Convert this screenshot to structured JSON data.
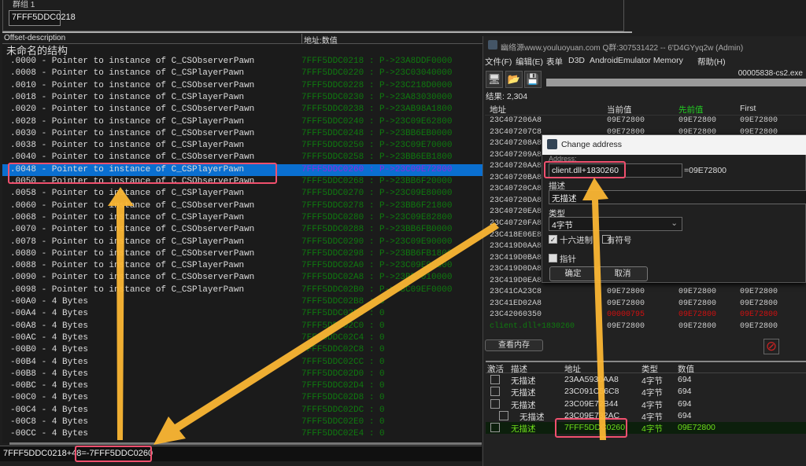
{
  "group": {
    "title": "群组 1",
    "address": "7FFF5DDC0218"
  },
  "struct": {
    "col_offset": "Offset-description",
    "col_value": "地址:数值",
    "title": "未命名的结构",
    "rows": [
      {
        "d": ".0000 - Pointer to instance of C_CSObserverPawn",
        "v": "7FFF5DDC0218 : P->23A8DDF0000"
      },
      {
        "d": ".0008 - Pointer to instance of C_CSPlayerPawn",
        "v": "7FFF5DDC0220 : P->23C03040000"
      },
      {
        "d": ".0010 - Pointer to instance of C_CSObserverPawn",
        "v": "7FFF5DDC0228 : P->23C218D0000"
      },
      {
        "d": ".0018 - Pointer to instance of C_CSPlayerPawn",
        "v": "7FFF5DDC0230 : P->23A83030000"
      },
      {
        "d": ".0020 - Pointer to instance of C_CSObserverPawn",
        "v": "7FFF5DDC0238 : P->23AB98A1800"
      },
      {
        "d": ".0028 - Pointer to instance of C_CSPlayerPawn",
        "v": "7FFF5DDC0240 : P->23C09E62800"
      },
      {
        "d": ".0030 - Pointer to instance of C_CSObserverPawn",
        "v": "7FFF5DDC0248 : P->23BB6EB0000"
      },
      {
        "d": ".0038 - Pointer to instance of C_CSPlayerPawn",
        "v": "7FFF5DDC0250 : P->23C09E70000"
      },
      {
        "d": ".0040 - Pointer to instance of C_CSObserverPawn",
        "v": "7FFF5DDC0258 : P->23BB6EB1800"
      },
      {
        "d": ".0048 - Pointer to instance of C_CSPlayerPawn",
        "v": "7FFF5DDC0260 : P->23C09E72800",
        "selected": true
      },
      {
        "d": ".0050 - Pointer to instance of C_CSObserverPawn",
        "v": "7FFF5DDC0268 : P->23BB6F20000"
      },
      {
        "d": ".0058 - Pointer to instance of C_CSPlayerPawn",
        "v": "7FFF5DDC0270 : P->23C09E80000"
      },
      {
        "d": ".0060 - Pointer to instance of C_CSObserverPawn",
        "v": "7FFF5DDC0278 : P->23BB6F21800"
      },
      {
        "d": ".0068 - Pointer to instance of C_CSPlayerPawn",
        "v": "7FFF5DDC0280 : P->23C09E82800"
      },
      {
        "d": ".0070 - Pointer to instance of C_CSObserverPawn",
        "v": "7FFF5DDC0288 : P->23BB6FB0000"
      },
      {
        "d": ".0078 - Pointer to instance of C_CSPlayerPawn",
        "v": "7FFF5DDC0290 : P->23C09E90000"
      },
      {
        "d": ".0080 - Pointer to instance of C_CSObserverPawn",
        "v": "7FFF5DDC0298 : P->23BB6FB1800"
      },
      {
        "d": ".0088 - Pointer to instance of C_CSPlayerPawn",
        "v": "7FFF5DDC02A0 : P->23C09E92800"
      },
      {
        "d": ".0090 - Pointer to instance of C_CSObserverPawn",
        "v": "7FFF5DDC02A8 : P->23BB7010000"
      },
      {
        "d": ".0098 - Pointer to instance of C_CSPlayerPawn",
        "v": "7FFF5DDC02B0 : P->23C09EF0000"
      },
      {
        "d": "-00A0 - 4 Bytes",
        "v": "7FFF5DDC02B8 : 0"
      },
      {
        "d": "-00A4 - 4 Bytes",
        "v": "7FFF5DDC02BC : 0"
      },
      {
        "d": "-00A8 - 4 Bytes",
        "v": "7FFF5DDC02C0 : 0"
      },
      {
        "d": "-00AC - 4 Bytes",
        "v": "7FFF5DDC02C4 : 0"
      },
      {
        "d": "-00B0 - 4 Bytes",
        "v": "7FFF5DDC02C8 : 0"
      },
      {
        "d": "-00B4 - 4 Bytes",
        "v": "7FFF5DDC02CC : 0"
      },
      {
        "d": "-00B8 - 4 Bytes",
        "v": "7FFF5DDC02D0 : 0"
      },
      {
        "d": "-00BC - 4 Bytes",
        "v": "7FFF5DDC02D4 : 0"
      },
      {
        "d": "-00C0 - 4 Bytes",
        "v": "7FFF5DDC02D8 : 0"
      },
      {
        "d": "-00C4 - 4 Bytes",
        "v": "7FFF5DDC02DC : 0"
      },
      {
        "d": "-00C8 - 4 Bytes",
        "v": "7FFF5DDC02E0 : 0"
      },
      {
        "d": "-00CC - 4 Bytes",
        "v": "7FFF5DDC02E4 : 0"
      }
    ]
  },
  "status": {
    "text": "7FFF5DDC0218+48=-7FFF5DDC0260"
  },
  "ce": {
    "title": "幽络源www.youluoyuan.com Q群:307531422  --  6'D4GYyq2w (Admin)",
    "menu": [
      "文件(F)",
      "编辑(E)",
      "表单",
      "D3D",
      "Android",
      "Emulator Memory",
      "帮助(H)"
    ],
    "process": "00005838-cs2.exe",
    "results": "结果: 2,304",
    "result_headers": [
      "地址",
      "当前值",
      "先前值",
      "First"
    ],
    "result_rows": [
      [
        "23C407206A8",
        "09E72800",
        "09E72800",
        "09E72800"
      ],
      [
        "23C407207C8",
        "09E72800",
        "09E72800",
        "09E72800"
      ],
      [
        "23C407208A8",
        "",
        "",
        ""
      ],
      [
        "23C407209A8",
        "",
        "",
        ""
      ],
      [
        "23C40720AA8",
        "",
        "",
        ""
      ],
      [
        "23C40720BA8",
        "",
        "",
        ""
      ],
      [
        "23C40720CA8",
        "",
        "",
        ""
      ],
      [
        "23C40720DA8",
        "",
        "",
        ""
      ],
      [
        "23C40720EA8",
        "",
        "",
        ""
      ],
      [
        "23C40720FA8",
        "",
        "",
        ""
      ],
      [
        "23C418E06E8",
        "",
        "",
        ""
      ],
      [
        "23C419D0AA8",
        "",
        "",
        ""
      ],
      [
        "23C419D0BA8",
        "",
        "",
        ""
      ],
      [
        "23C419D0DA8",
        "",
        "",
        ""
      ],
      [
        "23C419D0EA8",
        "",
        "",
        ""
      ],
      [
        "23C41CA23C8",
        "09E72800",
        "09E72800",
        "09E72800"
      ],
      [
        "23C41ED02A8",
        "09E72800",
        "09E72800",
        "09E72800"
      ],
      [
        "23C42060350",
        "00000795",
        "09E72800",
        "09E72800"
      ],
      [
        "client.dll+1830260",
        "09E72800",
        "09E72800",
        "09E72800"
      ]
    ],
    "view_memory": "查看内存",
    "addr_headers": [
      "激活",
      "描述",
      "地址",
      "类型",
      "数值"
    ],
    "addr_rows": [
      [
        "无描述",
        "23AA5930AA8",
        "4字节",
        "694"
      ],
      [
        "无描述",
        "23C091C56C8",
        "4字节",
        "694"
      ],
      [
        "无描述",
        "23C09E72B44",
        "4字节",
        "694"
      ],
      [
        "无描述",
        "23C09E732AC",
        "4字节",
        "694"
      ],
      [
        "无描述",
        "7FFF5DDC0260",
        "4字节",
        "09E72800"
      ]
    ]
  },
  "dialog": {
    "title": "Change address",
    "address_label": "Address:",
    "address_value": "client.dll+1830260",
    "address_result": "=09E72800",
    "desc_label": "描述",
    "desc_value": "无描述",
    "type_label": "类型",
    "type_value": "4字节",
    "hex_label": "十六进制",
    "hex_checked": true,
    "signed_label": "有符号",
    "signed_checked": false,
    "pointer_label": "指针",
    "pointer_checked": false,
    "ok": "确定",
    "cancel": "取消"
  },
  "colors": {
    "highlight": "#f0506e",
    "arrow": "#fbb634",
    "selection": "#0a6fd0",
    "green_text": "#0f7a0f",
    "red_text": "#d01010"
  }
}
